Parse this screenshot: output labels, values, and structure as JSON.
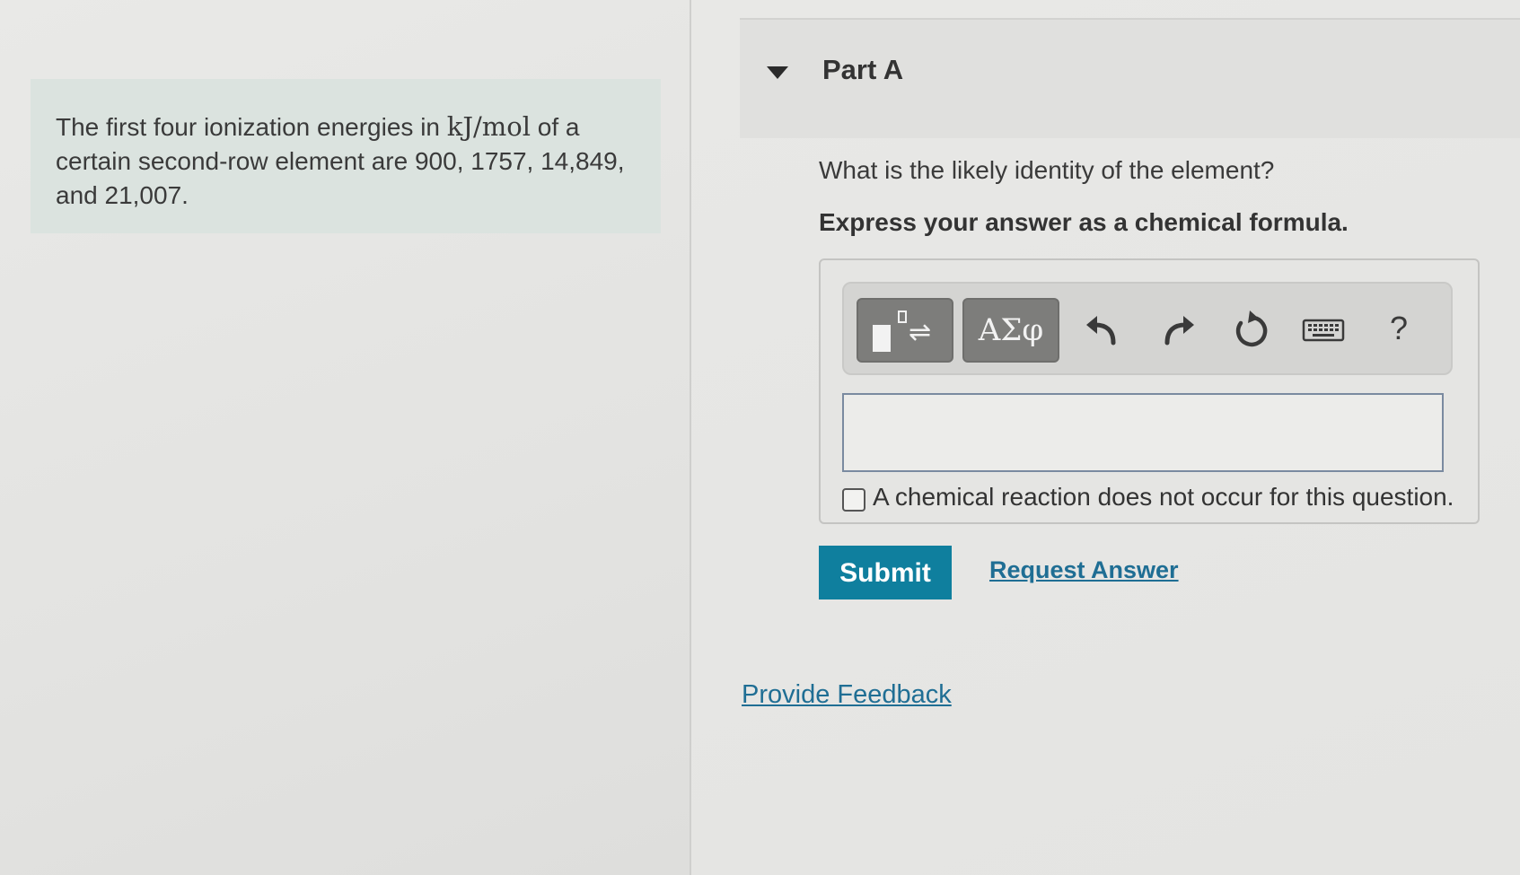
{
  "problem": {
    "text_before": "The first four ionization energies in ",
    "units": "kJ/mol",
    "text_after": " of a certain second-row element are 900, 1757, 14,849, and 21,007."
  },
  "part": {
    "title": "Part A",
    "question": "What is the likely identity of the element?",
    "instruction": "Express your answer as a chemical formula."
  },
  "toolbar": {
    "greek_label": "ΑΣφ",
    "help_label": "?"
  },
  "answer": {
    "value": "",
    "checkbox_label": "A chemical reaction does not occur for this question.",
    "checkbox_checked": false
  },
  "actions": {
    "submit_label": "Submit",
    "request_answer_label": "Request Answer",
    "feedback_label": "Provide Feedback"
  },
  "colors": {
    "submit_bg": "#0f7f9e",
    "link": "#1f6e94",
    "problem_bg": "#dbe3df"
  }
}
